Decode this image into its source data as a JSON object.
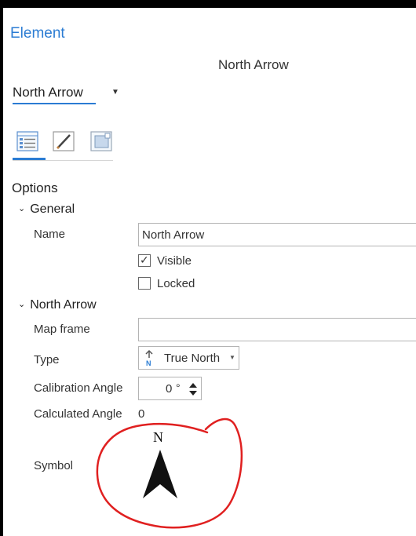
{
  "pane": {
    "title": "Element",
    "subtitle": "North Arrow"
  },
  "element_selector": {
    "value": "North Arrow"
  },
  "tabs": [
    {
      "name": "options",
      "icon": "options-list-icon",
      "selected": true
    },
    {
      "name": "display",
      "icon": "pencil-icon",
      "selected": false
    },
    {
      "name": "placement",
      "icon": "placement-icon",
      "selected": false
    }
  ],
  "options": {
    "header": "Options",
    "general": {
      "header": "General",
      "name_label": "Name",
      "name_value": "North Arrow",
      "visible_label": "Visible",
      "visible_checked": true,
      "locked_label": "Locked",
      "locked_checked": false
    },
    "north_arrow": {
      "header": "North Arrow",
      "map_frame_label": "Map frame",
      "map_frame_value": "",
      "type_label": "Type",
      "type_value": "True North",
      "calibration_label": "Calibration Angle",
      "calibration_value": "0",
      "calibration_unit": "°",
      "calculated_label": "Calculated Angle",
      "calculated_value": "0",
      "symbol_label": "Symbol",
      "symbol_letter": "N"
    }
  },
  "colors": {
    "accent": "#2b7cd3",
    "annotation": "#e02020",
    "arrow": "#111111"
  }
}
